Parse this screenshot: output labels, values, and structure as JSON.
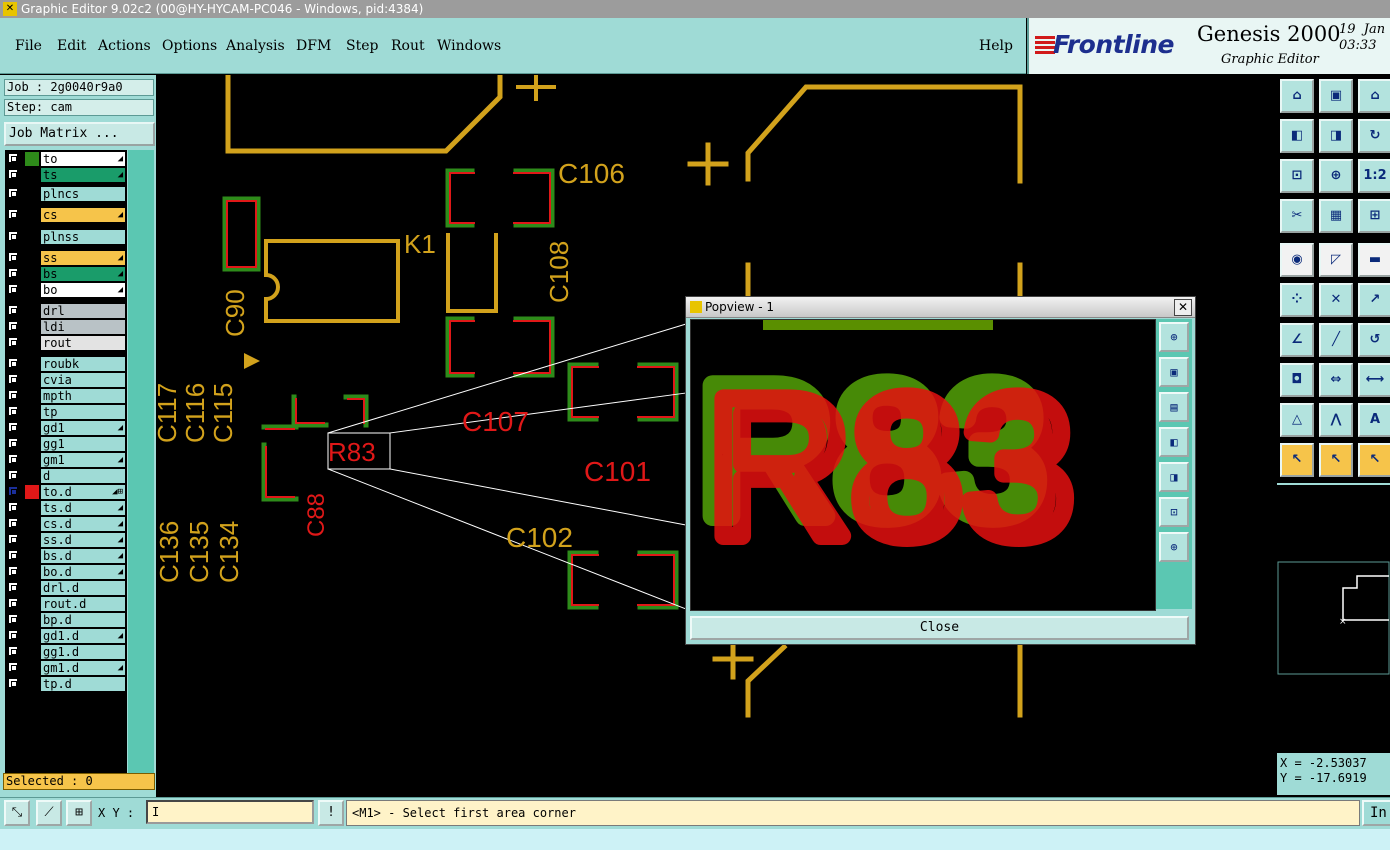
{
  "window": {
    "title": "Graphic Editor 9.02c2 (00@HY-HYCAM-PC046 - Windows, pid:4384)"
  },
  "menu": {
    "file": "File",
    "edit": "Edit",
    "actions": "Actions",
    "options": "Options",
    "analysis": "Analysis",
    "dfm": "DFM",
    "step": "Step",
    "rout": "Rout",
    "windows": "Windows",
    "help": "Help"
  },
  "brand": {
    "logo": "Frontline",
    "product": "Genesis 2000",
    "subtitle": "Graphic Editor",
    "date_line1": "19  Jan",
    "date_line2": "03:33"
  },
  "job": {
    "job_label": "Job : 2g0040r9a0",
    "step_label": "Step: cam",
    "matrix_button": "Job Matrix ..."
  },
  "layers": [
    {
      "name": "to",
      "color": "#ffffff",
      "swatch": "#2e8b1a",
      "icon": "◢"
    },
    {
      "name": "ts",
      "color": "#1a9c6a",
      "swatch": "#000000",
      "icon": "◢"
    },
    {
      "name": "plncs",
      "color": "#9fdbd6",
      "swatch": "#000000",
      "icon": ""
    },
    {
      "name": "cs",
      "color": "#f6c44a",
      "swatch": "#000000",
      "icon": "◢"
    },
    {
      "name": "plnss",
      "color": "#9fdbd6",
      "swatch": "#000000",
      "icon": ""
    },
    {
      "name": "ss",
      "color": "#f6c44a",
      "swatch": "#000000",
      "icon": "◢"
    },
    {
      "name": "bs",
      "color": "#1a9c6a",
      "swatch": "#000000",
      "icon": "◢"
    },
    {
      "name": "bo",
      "color": "#ffffff",
      "swatch": "#000000",
      "icon": "◢"
    },
    {
      "name": "drl",
      "color": "#b9c2c6",
      "swatch": "#000000",
      "icon": ""
    },
    {
      "name": "ldi",
      "color": "#b9c2c6",
      "swatch": "#000000",
      "icon": ""
    },
    {
      "name": "rout",
      "color": "#e3e3e3",
      "swatch": "#000000",
      "icon": ""
    },
    {
      "name": "roubk",
      "color": "#9fdbd6",
      "swatch": "#000000",
      "icon": ""
    },
    {
      "name": "cvia",
      "color": "#9fdbd6",
      "swatch": "#000000",
      "icon": ""
    },
    {
      "name": "mpth",
      "color": "#9fdbd6",
      "swatch": "#000000",
      "icon": ""
    },
    {
      "name": "tp",
      "color": "#9fdbd6",
      "swatch": "#000000",
      "icon": ""
    },
    {
      "name": "gd1",
      "color": "#9fdbd6",
      "swatch": "#000000",
      "icon": "◢"
    },
    {
      "name": "gg1",
      "color": "#9fdbd6",
      "swatch": "#000000",
      "icon": ""
    },
    {
      "name": "gm1",
      "color": "#9fdbd6",
      "swatch": "#000000",
      "icon": "◢"
    },
    {
      "name": "d",
      "color": "#9fdbd6",
      "swatch": "#000000",
      "icon": ""
    },
    {
      "name": "to.d",
      "color": "#9fdbd6",
      "swatch": "#e01818",
      "icon": "◢⊞"
    },
    {
      "name": "ts.d",
      "color": "#9fdbd6",
      "swatch": "#000000",
      "icon": "◢"
    },
    {
      "name": "cs.d",
      "color": "#9fdbd6",
      "swatch": "#000000",
      "icon": "◢"
    },
    {
      "name": "ss.d",
      "color": "#9fdbd6",
      "swatch": "#000000",
      "icon": "◢"
    },
    {
      "name": "bs.d",
      "color": "#9fdbd6",
      "swatch": "#000000",
      "icon": "◢"
    },
    {
      "name": "bo.d",
      "color": "#9fdbd6",
      "swatch": "#000000",
      "icon": "◢"
    },
    {
      "name": "drl.d",
      "color": "#9fdbd6",
      "swatch": "#000000",
      "icon": ""
    },
    {
      "name": "rout.d",
      "color": "#9fdbd6",
      "swatch": "#000000",
      "icon": ""
    },
    {
      "name": "bp.d",
      "color": "#9fdbd6",
      "swatch": "#000000",
      "icon": ""
    },
    {
      "name": "gd1.d",
      "color": "#9fdbd6",
      "swatch": "#000000",
      "icon": "◢"
    },
    {
      "name": "gg1.d",
      "color": "#9fdbd6",
      "swatch": "#000000",
      "icon": ""
    },
    {
      "name": "gm1.d",
      "color": "#9fdbd6",
      "swatch": "#000000",
      "icon": "◢"
    },
    {
      "name": "tp.d",
      "color": "#9fdbd6",
      "swatch": "#000000",
      "icon": ""
    }
  ],
  "selected": {
    "label": "Selected : 0"
  },
  "tools": [
    {
      "name": "zoom-home-icon",
      "glyph": "⌂",
      "style": ""
    },
    {
      "name": "zoom-out-icon",
      "glyph": "▣",
      "style": ""
    },
    {
      "name": "zoom-page-icon",
      "glyph": "⌂",
      "style": ""
    },
    {
      "name": "pan-left-icon",
      "glyph": "◧",
      "style": ""
    },
    {
      "name": "pan-right-icon",
      "glyph": "◨",
      "style": ""
    },
    {
      "name": "pan-redraw-icon",
      "glyph": "↻",
      "style": ""
    },
    {
      "name": "fit-screen-icon",
      "glyph": "⊡",
      "style": ""
    },
    {
      "name": "fit-center-icon",
      "glyph": "⊕",
      "style": ""
    },
    {
      "name": "scale-one-icon",
      "glyph": "1:2",
      "style": ""
    },
    {
      "name": "snap-settings-icon",
      "glyph": "✂",
      "style": ""
    },
    {
      "name": "grid-icon",
      "glyph": "▦",
      "style": ""
    },
    {
      "name": "connect-icon",
      "glyph": "⊞",
      "style": ""
    },
    {
      "name": "select-object-icon",
      "glyph": "◉",
      "style": "w"
    },
    {
      "name": "measure-icon",
      "glyph": "◸",
      "style": "w"
    },
    {
      "name": "ruler-icon",
      "glyph": "▬",
      "style": "w"
    },
    {
      "name": "node-edit-icon",
      "glyph": "⁘",
      "style": ""
    },
    {
      "name": "delete-node-icon",
      "glyph": "✕",
      "style": ""
    },
    {
      "name": "move-node-icon",
      "glyph": "↗",
      "style": ""
    },
    {
      "name": "draw-line-icon",
      "glyph": "∠",
      "style": ""
    },
    {
      "name": "draw-slope-icon",
      "glyph": "╱",
      "style": ""
    },
    {
      "name": "draw-arc-icon",
      "glyph": "↺",
      "style": ""
    },
    {
      "name": "pad-add-icon",
      "glyph": "◘",
      "style": ""
    },
    {
      "name": "split-line-icon",
      "glyph": "⇔",
      "style": ""
    },
    {
      "name": "dimension-icon",
      "glyph": "⟷",
      "style": ""
    },
    {
      "name": "angle-icon",
      "glyph": "△",
      "style": ""
    },
    {
      "name": "corner-icon",
      "glyph": "⋀",
      "style": ""
    },
    {
      "name": "text-add-icon",
      "glyph": "A",
      "style": ""
    },
    {
      "name": "pointer-icon",
      "glyph": "↖",
      "style": "o"
    },
    {
      "name": "pointer-select-icon",
      "glyph": "↖",
      "style": "o"
    },
    {
      "name": "pointer-area-icon",
      "glyph": "↖",
      "style": "o"
    }
  ],
  "coords": {
    "x_label": "X = -2.53037",
    "y_label": "Y = -17.6919"
  },
  "status": {
    "xy_label": "X Y :",
    "xy_value": "I",
    "prompt": "<M1> - Select first area corner",
    "in_button": "In"
  },
  "popview": {
    "title": "Popview - 1",
    "close_button": "Close",
    "zoom_text": "R83"
  },
  "board": {
    "labels": [
      {
        "t": "C106",
        "c": "#d2a21c"
      },
      {
        "t": "K1",
        "c": "#d2a21c"
      },
      {
        "t": "C108",
        "c": "#d2a21c"
      },
      {
        "t": "C90",
        "c": "#d2a21c"
      },
      {
        "t": "C117",
        "c": "#d2a21c"
      },
      {
        "t": "C116",
        "c": "#d2a21c"
      },
      {
        "t": "C115",
        "c": "#d2a21c"
      },
      {
        "t": "C107",
        "c": "#e01818"
      },
      {
        "t": "C101",
        "c": "#e01818"
      },
      {
        "t": "C102",
        "c": "#d2a21c"
      },
      {
        "t": "C88",
        "c": "#e01818"
      },
      {
        "t": "R83",
        "c": "#e01818"
      },
      {
        "t": "C136",
        "c": "#d2a21c"
      },
      {
        "t": "C135",
        "c": "#d2a21c"
      },
      {
        "t": "C134",
        "c": "#d2a21c"
      }
    ]
  }
}
